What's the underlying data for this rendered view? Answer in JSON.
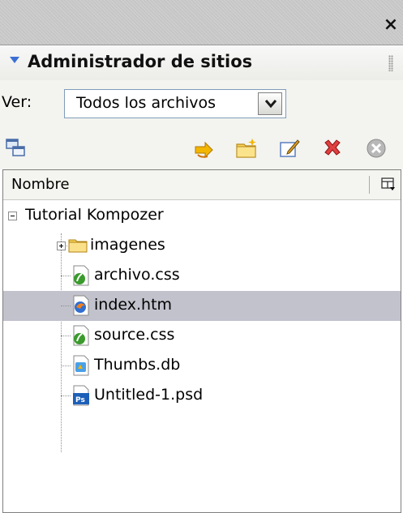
{
  "window": {
    "close_glyph": "×"
  },
  "panel": {
    "title": "Administrador de sitios"
  },
  "filter": {
    "label": "Ver:",
    "selected": "Todos los archivos"
  },
  "toolbar": {
    "icons": [
      "new-site-icon",
      "go-up-icon",
      "new-folder-icon",
      "edit-site-icon",
      "delete-icon",
      "stop-icon"
    ]
  },
  "tree": {
    "column_header": "Nombre",
    "root": "Tutorial Kompozer",
    "items": [
      {
        "label": "imagenes",
        "type": "folder",
        "expander": "plus"
      },
      {
        "label": "archivo.css",
        "type": "css"
      },
      {
        "label": "index.htm",
        "type": "html",
        "selected": true
      },
      {
        "label": "source.css",
        "type": "css"
      },
      {
        "label": "Thumbs.db",
        "type": "db"
      },
      {
        "label": "Untitled-1.psd",
        "type": "psd"
      }
    ]
  },
  "colors": {
    "accent": "#3c6fd4",
    "selection": "#c1c2cc",
    "border": "#7f9db9"
  }
}
